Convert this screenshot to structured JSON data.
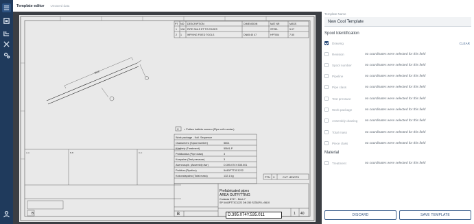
{
  "header": {
    "title": "Template editor",
    "subtitle": "Unsaved data"
  },
  "rail": {
    "icons": [
      "layers-icon",
      "document-list-icon",
      "pipe-icon",
      "tools-icon",
      "settings-gears-icon",
      "user-icon"
    ]
  },
  "drawing": {
    "bom_headers": [
      "PT",
      "NO",
      "DESCRIPTION",
      "DIMENSION",
      "MAT NR",
      "MASS"
    ],
    "bom_rows": [
      [
        "1",
        "128",
        "PIPE SMLS ET TO EDGES",
        "",
        "STEEL",
        "5.07"
      ],
      [
        "2",
        "1",
        "WRYING FIXED TOOLS",
        "DN65 40 47",
        "HP7004",
        "7.50"
      ]
    ],
    "dim_label": "3610",
    "pipe_number_hint": "= Putken kaikkia numero (Pipe coll number)",
    "info_rows": [
      [
        "Work package - Koll. Sequence",
        ""
      ],
      [
        "Osanumero (Spool number)",
        "5601"
      ],
      [
        "Käsittely (Treatment)",
        "55M1-P"
      ],
      [
        "Putkiluokka (Pipe class)",
        "3"
      ],
      [
        "Koepaine (Test pressure)",
        "3"
      ],
      [
        "Asennuspiir. (Assembly dwr)",
        "D.395.074Y.535.001"
      ],
      [
        "Putkitus (Pipeline)",
        "5443PTT3C1222"
      ],
      [
        "Kokonaispaino (Total mass)",
        "132.1 kg"
      ]
    ],
    "ptn_headers": [
      "PTN",
      "X",
      "CUT LENGTH"
    ],
    "company_lines": [
      "Prefabricated pipes",
      "AREA OUTFITTING",
      "Cruiseas 874Y - Deck 7",
      "SP 5443PTT3C1222 DN 250 S235JR L=5610"
    ],
    "drawing_number": "D.395.074Y.535.011",
    "rev": "B",
    "sheet_no": "1",
    "sheet_total": "40"
  },
  "panel": {
    "template_name_label": "Template Name",
    "template_name_value": "New Cool Template",
    "spool_section": "Spool Identification",
    "material_section": "Material",
    "clear_label": "CLEAR",
    "fields": [
      {
        "name": "Drawing",
        "checked": true,
        "message": ""
      },
      {
        "name": "Revision",
        "checked": false,
        "message": "no coordinates were selected for this field"
      },
      {
        "name": "Spool number",
        "checked": false,
        "message": "no coordinates were selected for this field"
      },
      {
        "name": "Pipeline",
        "checked": false,
        "message": "no coordinates were selected for this field"
      },
      {
        "name": "Pipe class",
        "checked": false,
        "message": "no coordinates were selected for this field"
      },
      {
        "name": "Test pressure",
        "checked": false,
        "message": "no coordinates were selected for this field"
      },
      {
        "name": "Work package",
        "checked": false,
        "message": "no coordinates were selected for this field"
      },
      {
        "name": "Assembly drawing",
        "checked": false,
        "message": "no coordinates were selected for this field"
      },
      {
        "name": "Total mass",
        "checked": false,
        "message": "no coordinates were selected for this field"
      },
      {
        "name": "Piece class",
        "checked": false,
        "message": "no coordinates were selected for this field"
      }
    ],
    "material_fields": [
      {
        "name": "Treatment",
        "checked": false,
        "message": "no coordinates were selected for this field"
      }
    ],
    "discard_label": "DISCARD",
    "save_label": "SAVE TEMPLATE"
  },
  "colors": {
    "rail": "#1f3a5c",
    "accent": "#2d4f7c",
    "canvas": "#3b3e43"
  }
}
